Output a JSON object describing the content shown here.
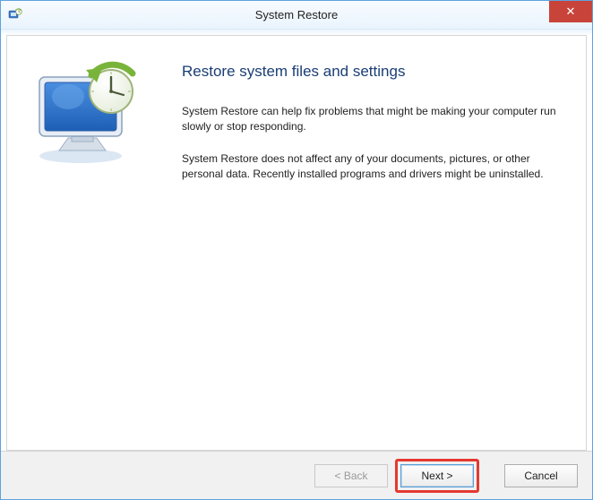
{
  "window": {
    "title": "System Restore"
  },
  "content": {
    "heading": "Restore system files and settings",
    "paragraph1": "System Restore can help fix problems that might be making your computer run slowly or stop responding.",
    "paragraph2": "System Restore does not affect any of your documents, pictures, or other personal data. Recently installed programs and drivers might be uninstalled."
  },
  "buttons": {
    "back": "< Back",
    "next": "Next >",
    "cancel": "Cancel",
    "close": "✕"
  }
}
